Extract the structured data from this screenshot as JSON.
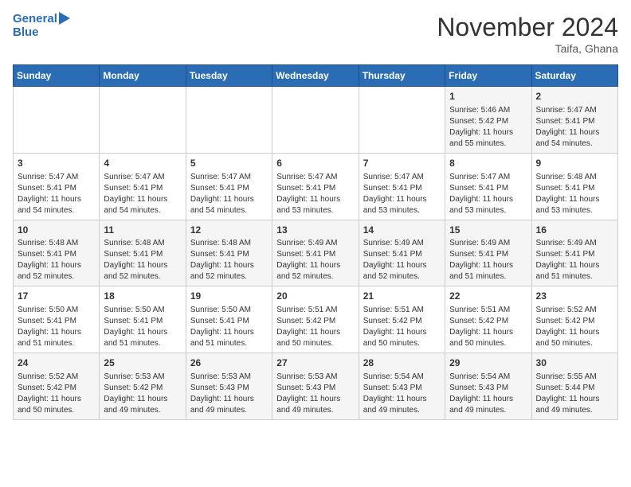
{
  "logo": {
    "line1": "General",
    "line2": "Blue"
  },
  "title": "November 2024",
  "subtitle": "Taifa, Ghana",
  "weekdays": [
    "Sunday",
    "Monday",
    "Tuesday",
    "Wednesday",
    "Thursday",
    "Friday",
    "Saturday"
  ],
  "weeks": [
    [
      {
        "day": "",
        "info": ""
      },
      {
        "day": "",
        "info": ""
      },
      {
        "day": "",
        "info": ""
      },
      {
        "day": "",
        "info": ""
      },
      {
        "day": "",
        "info": ""
      },
      {
        "day": "1",
        "info": "Sunrise: 5:46 AM\nSunset: 5:42 PM\nDaylight: 11 hours\nand 55 minutes."
      },
      {
        "day": "2",
        "info": "Sunrise: 5:47 AM\nSunset: 5:41 PM\nDaylight: 11 hours\nand 54 minutes."
      }
    ],
    [
      {
        "day": "3",
        "info": "Sunrise: 5:47 AM\nSunset: 5:41 PM\nDaylight: 11 hours\nand 54 minutes."
      },
      {
        "day": "4",
        "info": "Sunrise: 5:47 AM\nSunset: 5:41 PM\nDaylight: 11 hours\nand 54 minutes."
      },
      {
        "day": "5",
        "info": "Sunrise: 5:47 AM\nSunset: 5:41 PM\nDaylight: 11 hours\nand 54 minutes."
      },
      {
        "day": "6",
        "info": "Sunrise: 5:47 AM\nSunset: 5:41 PM\nDaylight: 11 hours\nand 53 minutes."
      },
      {
        "day": "7",
        "info": "Sunrise: 5:47 AM\nSunset: 5:41 PM\nDaylight: 11 hours\nand 53 minutes."
      },
      {
        "day": "8",
        "info": "Sunrise: 5:47 AM\nSunset: 5:41 PM\nDaylight: 11 hours\nand 53 minutes."
      },
      {
        "day": "9",
        "info": "Sunrise: 5:48 AM\nSunset: 5:41 PM\nDaylight: 11 hours\nand 53 minutes."
      }
    ],
    [
      {
        "day": "10",
        "info": "Sunrise: 5:48 AM\nSunset: 5:41 PM\nDaylight: 11 hours\nand 52 minutes."
      },
      {
        "day": "11",
        "info": "Sunrise: 5:48 AM\nSunset: 5:41 PM\nDaylight: 11 hours\nand 52 minutes."
      },
      {
        "day": "12",
        "info": "Sunrise: 5:48 AM\nSunset: 5:41 PM\nDaylight: 11 hours\nand 52 minutes."
      },
      {
        "day": "13",
        "info": "Sunrise: 5:49 AM\nSunset: 5:41 PM\nDaylight: 11 hours\nand 52 minutes."
      },
      {
        "day": "14",
        "info": "Sunrise: 5:49 AM\nSunset: 5:41 PM\nDaylight: 11 hours\nand 52 minutes."
      },
      {
        "day": "15",
        "info": "Sunrise: 5:49 AM\nSunset: 5:41 PM\nDaylight: 11 hours\nand 51 minutes."
      },
      {
        "day": "16",
        "info": "Sunrise: 5:49 AM\nSunset: 5:41 PM\nDaylight: 11 hours\nand 51 minutes."
      }
    ],
    [
      {
        "day": "17",
        "info": "Sunrise: 5:50 AM\nSunset: 5:41 PM\nDaylight: 11 hours\nand 51 minutes."
      },
      {
        "day": "18",
        "info": "Sunrise: 5:50 AM\nSunset: 5:41 PM\nDaylight: 11 hours\nand 51 minutes."
      },
      {
        "day": "19",
        "info": "Sunrise: 5:50 AM\nSunset: 5:41 PM\nDaylight: 11 hours\nand 51 minutes."
      },
      {
        "day": "20",
        "info": "Sunrise: 5:51 AM\nSunset: 5:42 PM\nDaylight: 11 hours\nand 50 minutes."
      },
      {
        "day": "21",
        "info": "Sunrise: 5:51 AM\nSunset: 5:42 PM\nDaylight: 11 hours\nand 50 minutes."
      },
      {
        "day": "22",
        "info": "Sunrise: 5:51 AM\nSunset: 5:42 PM\nDaylight: 11 hours\nand 50 minutes."
      },
      {
        "day": "23",
        "info": "Sunrise: 5:52 AM\nSunset: 5:42 PM\nDaylight: 11 hours\nand 50 minutes."
      }
    ],
    [
      {
        "day": "24",
        "info": "Sunrise: 5:52 AM\nSunset: 5:42 PM\nDaylight: 11 hours\nand 50 minutes."
      },
      {
        "day": "25",
        "info": "Sunrise: 5:53 AM\nSunset: 5:42 PM\nDaylight: 11 hours\nand 49 minutes."
      },
      {
        "day": "26",
        "info": "Sunrise: 5:53 AM\nSunset: 5:43 PM\nDaylight: 11 hours\nand 49 minutes."
      },
      {
        "day": "27",
        "info": "Sunrise: 5:53 AM\nSunset: 5:43 PM\nDaylight: 11 hours\nand 49 minutes."
      },
      {
        "day": "28",
        "info": "Sunrise: 5:54 AM\nSunset: 5:43 PM\nDaylight: 11 hours\nand 49 minutes."
      },
      {
        "day": "29",
        "info": "Sunrise: 5:54 AM\nSunset: 5:43 PM\nDaylight: 11 hours\nand 49 minutes."
      },
      {
        "day": "30",
        "info": "Sunrise: 5:55 AM\nSunset: 5:44 PM\nDaylight: 11 hours\nand 49 minutes."
      }
    ]
  ]
}
